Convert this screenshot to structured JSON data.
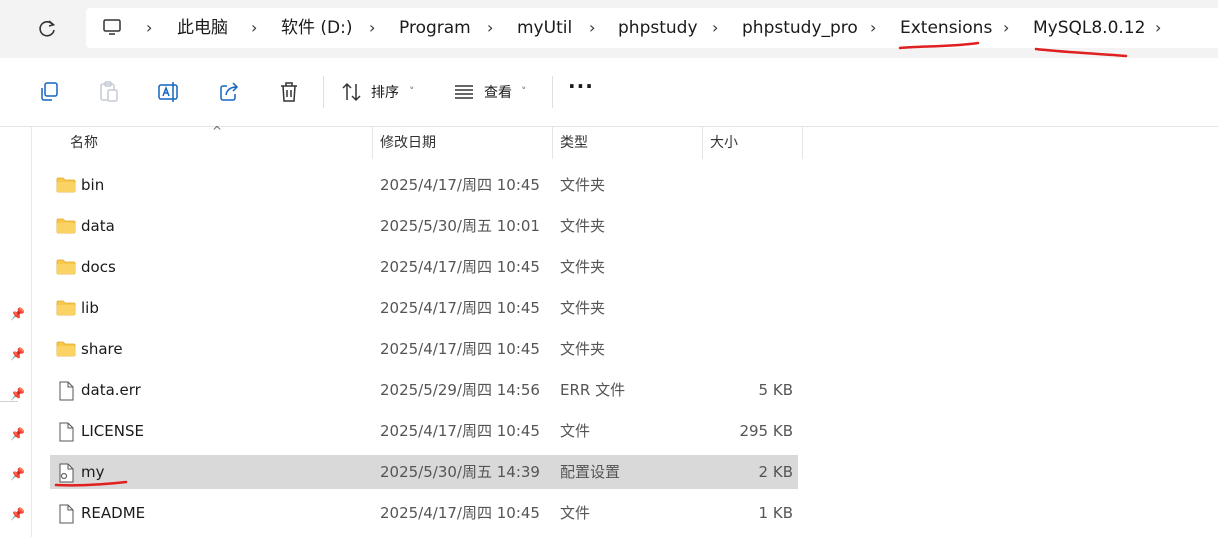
{
  "breadcrumb": {
    "items": [
      "此电脑",
      "软件 (D:)",
      "Program",
      "myUtil",
      "phpstudy",
      "phpstudy_pro",
      "Extensions",
      "MySQL8.0.12"
    ],
    "separator": "›"
  },
  "toolbar": {
    "sort_label": "排序",
    "view_label": "查看",
    "more_label": "···",
    "dropdown_caret": "˅"
  },
  "columns": {
    "name": "名称",
    "date": "修改日期",
    "type": "类型",
    "size": "大小",
    "sort_caret": "^"
  },
  "files": [
    {
      "name": "bin",
      "date": "2025/4/17/周四 10:45",
      "type": "文件夹",
      "size": "",
      "icon": "folder-icon"
    },
    {
      "name": "data",
      "date": "2025/5/30/周五 10:01",
      "type": "文件夹",
      "size": "",
      "icon": "folder-icon"
    },
    {
      "name": "docs",
      "date": "2025/4/17/周四 10:45",
      "type": "文件夹",
      "size": "",
      "icon": "folder-icon"
    },
    {
      "name": "lib",
      "date": "2025/4/17/周四 10:45",
      "type": "文件夹",
      "size": "",
      "icon": "folder-icon"
    },
    {
      "name": "share",
      "date": "2025/4/17/周四 10:45",
      "type": "文件夹",
      "size": "",
      "icon": "folder-icon"
    },
    {
      "name": "data.err",
      "date": "2025/5/29/周四 14:56",
      "type": "ERR 文件",
      "size": "5 KB",
      "icon": "file-icon"
    },
    {
      "name": "LICENSE",
      "date": "2025/4/17/周四 10:45",
      "type": "文件",
      "size": "295 KB",
      "icon": "file-icon"
    },
    {
      "name": "my",
      "date": "2025/5/30/周五 14:39",
      "type": "配置设置",
      "size": "2 KB",
      "icon": "config-file-icon",
      "selected": true
    },
    {
      "name": "README",
      "date": "2025/4/17/周四 10:45",
      "type": "文件",
      "size": "1 KB",
      "icon": "file-icon"
    }
  ],
  "colors": {
    "annotation": "#e02020",
    "selected_row": "#d9d9d9",
    "folder": "#f8c84a"
  }
}
